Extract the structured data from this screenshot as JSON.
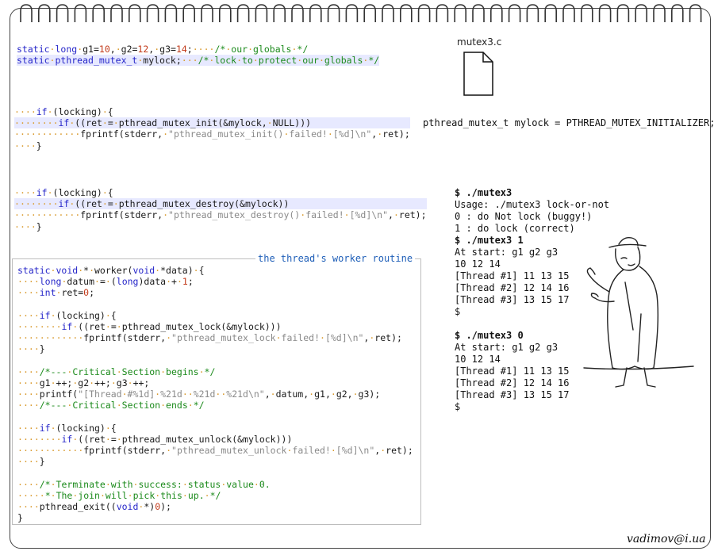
{
  "filename": "mutex3.c",
  "globals_lines": [
    "static long g1=10, g2=12, g3=14;    /* our globals */",
    "static pthread_mutex_t mylock;   /* lock to protect our globals */"
  ],
  "init_lines": [
    "    if (locking) {",
    "        if ((ret = pthread_mutex_init(&mylock, NULL)))",
    "            fprintf(stderr, \"pthread_mutex_init() failed! [%d]\\n\", ret);",
    "    }"
  ],
  "init_alt": "pthread_mutex_t mylock = PTHREAD_MUTEX_INITIALIZER;",
  "destroy_lines": [
    "    if (locking) {",
    "        if ((ret = pthread_mutex_destroy(&mylock))",
    "            fprintf(stderr, \"pthread_mutex_destroy() failed! [%d]\\n\", ret);",
    "    }"
  ],
  "worker_title": "the thread's worker routine",
  "worker_lines": [
    "static void * worker(void *data) {",
    "    long datum = (long)data + 1;",
    "    int ret=0;",
    "",
    "    if (locking) {",
    "        if ((ret = pthread_mutex_lock(&mylock)))",
    "            fprintf(stderr, \"pthread_mutex_lock failed! [%d]\\n\", ret);",
    "    }",
    "",
    "    /*--- Critical Section begins */",
    "    g1 ++; g2 ++; g3 ++;",
    "    printf(\"[Thread #%1d] %21d  %21d  %21d\\n\", datum, g1, g2, g3);",
    "    /*--- Critical Section ends */",
    "",
    "    if (locking) {",
    "        if ((ret = pthread_mutex_unlock(&mylock)))",
    "            fprintf(stderr, \"pthread_mutex_unlock failed! [%d]\\n\", ret);",
    "    }",
    "",
    "    /* Terminate with success: status value 0.",
    "     * The join will pick this up. */",
    "    pthread_exit((void *)0);",
    "}"
  ],
  "terminal_lines": [
    "$ ./mutex3",
    "Usage: ./mutex3 lock-or-not",
    "0 : do Not lock (buggy!)",
    "1 : do lock (correct)",
    "$ ./mutex3 1",
    "At start: g1 g2 g3",
    "10 12 14",
    "[Thread #1] 11 13 15",
    "[Thread #2] 12 14 16",
    "[Thread #3] 13 15 17",
    "$",
    "",
    "$ ./mutex3 0",
    "At start: g1 g2 g3",
    "10 12 14",
    "[Thread #1] 11 13 15",
    "[Thread #2] 12 14 16",
    "[Thread #3] 13 15 17",
    "$"
  ],
  "author": "vadimov@i.ua",
  "icons": {
    "file": "file-icon",
    "figure": "man-in-hat-figure-icon"
  },
  "colors": {
    "keyword": "#2626c9",
    "comment": "#1b8a1b",
    "string": "#8a8a8a",
    "number": "#c23a1a",
    "whitespace_dot": "#d99a2e",
    "highlight": "#e7e9ff",
    "worker_title": "#1f5fb8"
  }
}
